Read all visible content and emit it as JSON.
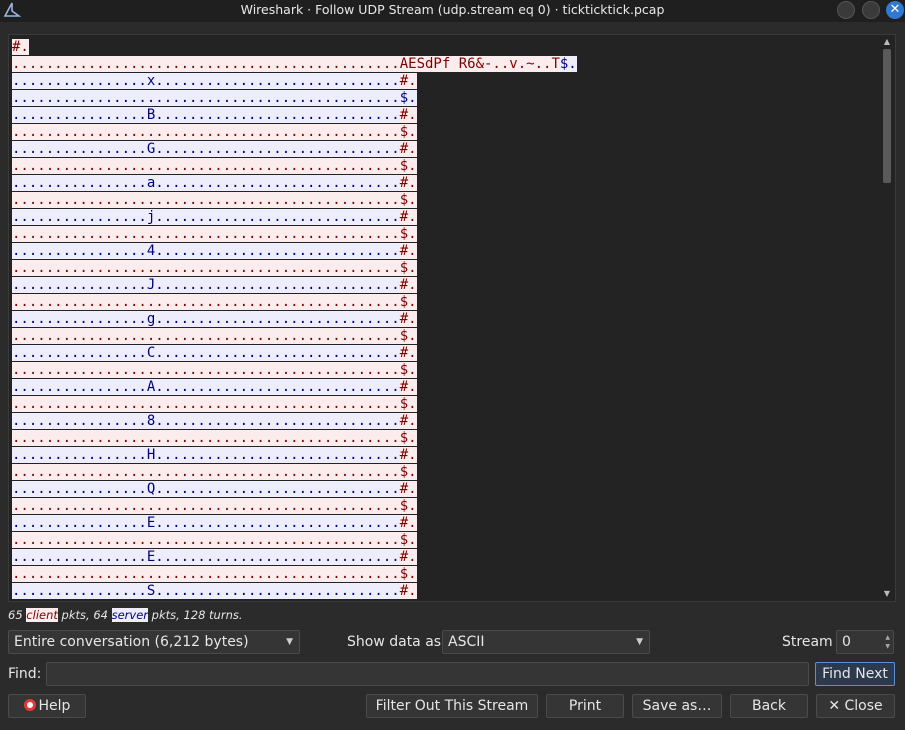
{
  "window": {
    "title": "Wireshark · Follow UDP Stream (udp.stream eq 0) · tickticktick.pcap",
    "close_glyph": "✕"
  },
  "colors": {
    "client_bg": "#fbeded",
    "client_fg": "#7f0000",
    "server_bg": "#ededfb",
    "server_fg": "#00007f",
    "accent": "#2f7ad0"
  },
  "stream": {
    "segments": [
      {
        "type": "client",
        "text": "#."
      },
      {
        "type": "client",
        "text": "..............................................AESdPf R6&-..v.~..T"
      },
      {
        "type": "server",
        "text": "$."
      },
      {
        "type": "server",
        "text": "................x..............................."
      },
      {
        "type": "client",
        "text": "#."
      },
      {
        "type": "server",
        "text": "..............................................$."
      },
      {
        "type": "client",
        "text": "................B..............................."
      },
      {
        "type": "server",
        "text": "$."
      },
      {
        "type": "client",
        "text": "..............................................#."
      },
      {
        "type": "server",
        "text": "................G..............................."
      },
      {
        "type": "client",
        "text": "#."
      },
      {
        "type": "server",
        "text": "..............................................$."
      },
      {
        "type": "client",
        "text": "................a..............................."
      },
      {
        "type": "server",
        "text": "$."
      },
      {
        "type": "client",
        "text": "..............................................#."
      },
      {
        "type": "server",
        "text": "................j..............................."
      },
      {
        "type": "client",
        "text": "#."
      },
      {
        "type": "server",
        "text": "..............................................$."
      },
      {
        "type": "client",
        "text": "................4..............................."
      },
      {
        "type": "server",
        "text": "$."
      },
      {
        "type": "client",
        "text": "..............................................#."
      },
      {
        "type": "server",
        "text": "................J..............................."
      },
      {
        "type": "client",
        "text": "#."
      },
      {
        "type": "server",
        "text": "..............................................$."
      },
      {
        "type": "client",
        "text": "................g..............................."
      },
      {
        "type": "server",
        "text": "$."
      },
      {
        "type": "client",
        "text": "..............................................#."
      },
      {
        "type": "server",
        "text": "................C..............................."
      },
      {
        "type": "client",
        "text": "#."
      },
      {
        "type": "server",
        "text": "..............................................$."
      },
      {
        "type": "client",
        "text": "................A..............................."
      },
      {
        "type": "server",
        "text": "$."
      },
      {
        "type": "client",
        "text": "..............................................#."
      },
      {
        "type": "server",
        "text": "................8..............................."
      },
      {
        "type": "client",
        "text": "#."
      },
      {
        "type": "server",
        "text": "..............................................$."
      },
      {
        "type": "client",
        "text": "................H..............................."
      },
      {
        "type": "server",
        "text": "$."
      },
      {
        "type": "client",
        "text": "..............................................#."
      },
      {
        "type": "server",
        "text": "................Q..............................."
      },
      {
        "type": "client",
        "text": "#."
      },
      {
        "type": "server",
        "text": "..............................................$."
      },
      {
        "type": "client",
        "text": "................E..............................."
      },
      {
        "type": "server",
        "text": "$."
      },
      {
        "type": "client",
        "text": "..............................................#."
      },
      {
        "type": "server",
        "text": "................E..............................."
      },
      {
        "type": "client",
        "text": "#."
      },
      {
        "type": "server",
        "text": "..............................................$."
      },
      {
        "type": "client",
        "text": "................S..............................."
      },
      {
        "type": "client",
        "text": "#."
      }
    ]
  },
  "lines": [
    [
      {
        "t": "client",
        "s": "#."
      }
    ],
    [
      {
        "t": "client",
        "s": "..............................................AESdPf R6&-..v.~..T"
      },
      {
        "t": "server",
        "s": "$."
      }
    ],
    [
      {
        "t": "server",
        "s": "................x............................."
      },
      {
        "t": "client",
        "s": "#."
      }
    ],
    [
      {
        "t": "server",
        "s": "..............................................$."
      }
    ],
    [
      {
        "t": "server",
        "s": "................B............................."
      },
      {
        "t": "client",
        "s": "#."
      }
    ],
    [
      {
        "t": "client",
        "s": "..............................................$."
      }
    ],
    [
      {
        "t": "server",
        "s": "................G............................."
      },
      {
        "t": "client",
        "s": "#."
      }
    ],
    [
      {
        "t": "client",
        "s": "..............................................$."
      }
    ],
    [
      {
        "t": "server",
        "s": "................a............................."
      },
      {
        "t": "client",
        "s": "#."
      }
    ],
    [
      {
        "t": "client",
        "s": "..............................................$."
      }
    ],
    [
      {
        "t": "server",
        "s": "................j............................."
      },
      {
        "t": "client",
        "s": "#."
      }
    ],
    [
      {
        "t": "client",
        "s": "..............................................$."
      }
    ],
    [
      {
        "t": "server",
        "s": "................4............................."
      },
      {
        "t": "client",
        "s": "#."
      }
    ],
    [
      {
        "t": "client",
        "s": "..............................................$."
      }
    ],
    [
      {
        "t": "server",
        "s": "................J............................."
      },
      {
        "t": "client",
        "s": "#."
      }
    ],
    [
      {
        "t": "client",
        "s": "..............................................$."
      }
    ],
    [
      {
        "t": "server",
        "s": "................g............................."
      },
      {
        "t": "client",
        "s": "#."
      }
    ],
    [
      {
        "t": "client",
        "s": "..............................................$."
      }
    ],
    [
      {
        "t": "server",
        "s": "................C............................."
      },
      {
        "t": "client",
        "s": "#."
      }
    ],
    [
      {
        "t": "client",
        "s": "..............................................$."
      }
    ],
    [
      {
        "t": "server",
        "s": "................A............................."
      },
      {
        "t": "client",
        "s": "#."
      }
    ],
    [
      {
        "t": "client",
        "s": "..............................................$."
      }
    ],
    [
      {
        "t": "server",
        "s": "................8............................."
      },
      {
        "t": "client",
        "s": "#."
      }
    ],
    [
      {
        "t": "client",
        "s": "..............................................$."
      }
    ],
    [
      {
        "t": "server",
        "s": "................H............................."
      },
      {
        "t": "client",
        "s": "#."
      }
    ],
    [
      {
        "t": "client",
        "s": "..............................................$."
      }
    ],
    [
      {
        "t": "server",
        "s": "................Q............................."
      },
      {
        "t": "client",
        "s": "#."
      }
    ],
    [
      {
        "t": "client",
        "s": "..............................................$."
      }
    ],
    [
      {
        "t": "server",
        "s": "................E............................."
      },
      {
        "t": "client",
        "s": "#."
      }
    ],
    [
      {
        "t": "client",
        "s": "..............................................$."
      }
    ],
    [
      {
        "t": "server",
        "s": "................E............................."
      },
      {
        "t": "client",
        "s": "#."
      }
    ],
    [
      {
        "t": "client",
        "s": "..............................................$."
      }
    ],
    [
      {
        "t": "server",
        "s": "................S............................."
      },
      {
        "t": "client",
        "s": "#."
      }
    ]
  ],
  "stats": {
    "client_count": "65",
    "client_label": "client",
    "mid": "pkts, 64",
    "server_label": "server",
    "tail": "pkts, 128 turns."
  },
  "controls": {
    "conversation": "Entire conversation (6,212 bytes)",
    "show_data_label": "Show data as",
    "show_data_value": "ASCII",
    "stream_label": "Stream",
    "stream_value": "0",
    "find_label": "Find:",
    "find_value": "",
    "find_next": "Find Next"
  },
  "buttons": {
    "help": "Help",
    "filter_out": "Filter Out This Stream",
    "print": "Print",
    "save_as": "Save as…",
    "back": "Back",
    "close": "Close",
    "close_glyph": "✕"
  }
}
